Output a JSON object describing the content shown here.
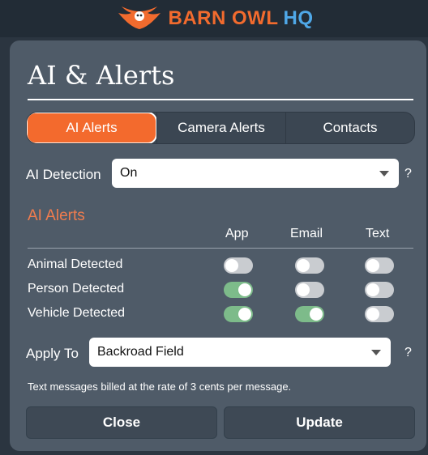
{
  "brand": {
    "name_part1": "BARN OWL",
    "name_part2": "HQ",
    "accent": "#f26b2e",
    "hq_color": "#4fa8e8"
  },
  "modal": {
    "title": "AI & Alerts"
  },
  "tabs": [
    {
      "label": "AI Alerts",
      "active": true
    },
    {
      "label": "Camera Alerts",
      "active": false
    },
    {
      "label": "Contacts",
      "active": false
    }
  ],
  "ai_detection": {
    "label": "AI Detection",
    "value": "On",
    "help": "?"
  },
  "section": {
    "title": "AI Alerts",
    "columns": [
      "App",
      "Email",
      "Text"
    ]
  },
  "alerts": [
    {
      "label": "Animal Detected",
      "app": false,
      "email": false,
      "text": false
    },
    {
      "label": "Person Detected",
      "app": true,
      "email": false,
      "text": false
    },
    {
      "label": "Vehicle Detected",
      "app": true,
      "email": true,
      "text": false
    }
  ],
  "apply_to": {
    "label": "Apply To",
    "value": "Backroad Field",
    "help": "?"
  },
  "note": "Text messages billed at the rate of 3 cents per message.",
  "buttons": {
    "close": "Close",
    "update": "Update"
  },
  "colors": {
    "tab_active": "#f36a2d",
    "toggle_on": "#7dbb8a",
    "toggle_off": "#c9ccd0",
    "section_title": "#f07c4e"
  }
}
